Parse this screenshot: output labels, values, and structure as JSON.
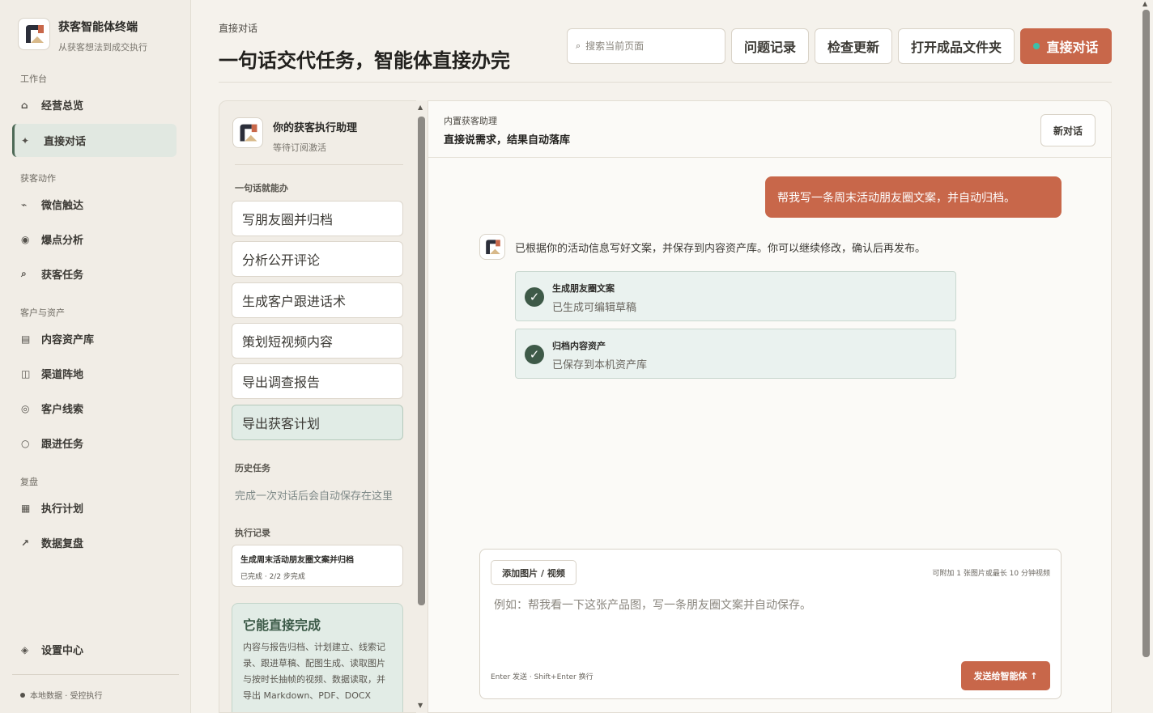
{
  "brand": {
    "title": "获客智能体终端",
    "subtitle": "从获客想法到成交执行"
  },
  "sidebar": {
    "sections": [
      {
        "label": "工作台"
      },
      {
        "label": "获客动作"
      },
      {
        "label": "客户与资产"
      },
      {
        "label": "复盘"
      }
    ],
    "items": [
      {
        "label": "经营总览",
        "icon": "home-icon",
        "glyph": "⌂"
      },
      {
        "label": "直接对话",
        "icon": "sparkle-icon",
        "glyph": "✦"
      },
      {
        "label": "微信触达",
        "icon": "arrow-icon",
        "glyph": "⌁"
      },
      {
        "label": "爆点分析",
        "icon": "target-icon",
        "glyph": "◉"
      },
      {
        "label": "获客任务",
        "icon": "search-icon",
        "glyph": "⌕"
      },
      {
        "label": "内容资产库",
        "icon": "list-icon",
        "glyph": "▤"
      },
      {
        "label": "渠道阵地",
        "icon": "columns-icon",
        "glyph": "◫"
      },
      {
        "label": "客户线索",
        "icon": "dot-circle-icon",
        "glyph": "◎"
      },
      {
        "label": "跟进任务",
        "icon": "circle-icon",
        "glyph": "○"
      },
      {
        "label": "执行计划",
        "icon": "grid-icon",
        "glyph": "▦"
      },
      {
        "label": "数据复盘",
        "icon": "trend-icon",
        "glyph": "↗"
      },
      {
        "label": "设置中心",
        "icon": "diamond-icon",
        "glyph": "◈"
      }
    ],
    "status": "本地数据 · 受控执行"
  },
  "header": {
    "eyebrow": "直接对话",
    "title": "一句话交代任务，智能体直接办完",
    "search_placeholder": "搜索当前页面",
    "buttons": {
      "issues": "问题记录",
      "update": "检查更新",
      "open_folder": "打开成品文件夹",
      "direct_chat": "直接对话"
    }
  },
  "left_panel": {
    "assistant_name": "你的获客执行助理",
    "assistant_state": "等待订阅激活",
    "quick_heading": "一句话就能办",
    "quick_actions": [
      "写朋友圈并归档",
      "分析公开评论",
      "生成客户跟进话术",
      "策划短视频内容",
      "导出调查报告",
      "导出获客计划"
    ],
    "history_heading": "历史任务",
    "history_note": "完成一次对话后会自动保存在这里",
    "records_heading": "执行记录",
    "record": {
      "title": "生成周末活动朋友圈文案并归档",
      "meta": "已完成 · 2/2 步完成"
    },
    "feature": {
      "title": "它能直接完成",
      "desc": "内容与报告归档、计划建立、线索记录、跟进草稿、配图生成、读取图片与按时长抽帧的视频、数据读取，并导出 Markdown、PDF、DOCX"
    }
  },
  "chat": {
    "eyebrow": "内置获客助理",
    "title": "直接说需求，结果自动落库",
    "new_chat": "新对话",
    "user_message": "帮我写一条周末活动朋友圈文案，并自动归档。",
    "bot_message": "已根据你的活动信息写好文案，并保存到内容资产库。你可以继续修改，确认后再发布。",
    "steps": [
      {
        "title": "生成朋友圈文案",
        "desc": "已生成可编辑草稿"
      },
      {
        "title": "归档内容资产",
        "desc": "已保存到本机资产库"
      }
    ],
    "composer": {
      "attach": "添加图片 / 视频",
      "attach_hint": "可附加 1 张图片或最长 10 分钟视频",
      "placeholder": "例如：帮我看一下这张产品图，写一条朋友圈文案并自动保存。",
      "key_hint": "Enter 发送 · Shift+Enter 换行",
      "send": "发送给智能体 ↑"
    }
  },
  "colors": {
    "accent": "#c8674a",
    "sage": "#4e6a57",
    "online": "#3cc0a8"
  }
}
